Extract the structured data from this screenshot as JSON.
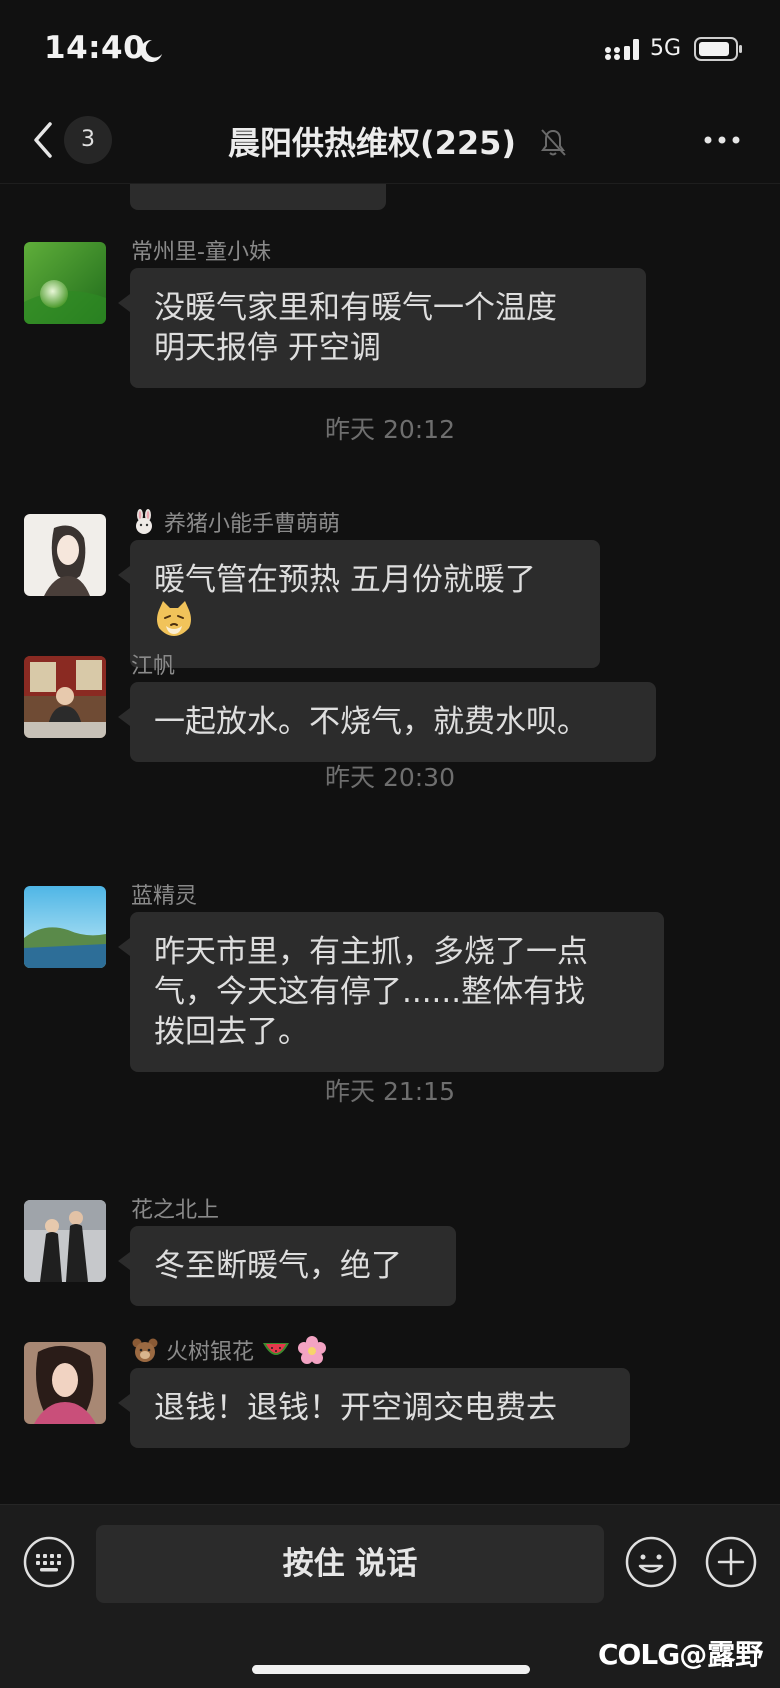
{
  "status_bar": {
    "time": "14:40",
    "network": "5G",
    "icons": [
      "moon-icon",
      "signal-icon",
      "battery-icon"
    ]
  },
  "header": {
    "unread_count": "3",
    "title": "晨阳供热维权(225)",
    "icons": [
      "back-icon",
      "mute-icon",
      "more-icon"
    ]
  },
  "messages": [
    {
      "sender": "常州里-童小妹",
      "text_lines": [
        "没暖气家里和有暖气一个温度",
        "明天报停 开空调"
      ]
    },
    {
      "timestamp": "昨天 20:12"
    },
    {
      "sender": "养猪小能手曹萌萌",
      "sender_prefix_icon": "rabbit-icon",
      "text": "暖气管在预热 五月份就暖了",
      "trailing_icon": "cat-emoji-icon"
    },
    {
      "sender": "江帆",
      "text": "一起放水。不烧气，就费水呗。"
    },
    {
      "timestamp": "昨天 20:30"
    },
    {
      "sender": "蓝精灵",
      "text_lines": [
        "昨天市里，有主抓，多烧了一点",
        "气，今天这有停了......整体有找",
        "拨回去了。"
      ]
    },
    {
      "timestamp": "昨天 21:15"
    },
    {
      "sender": "花之北上",
      "text": "冬至断暖气，绝了"
    },
    {
      "sender": "火树银花",
      "sender_prefix_icon": "bear-icon",
      "sender_suffix_icons": [
        "watermelon-icon",
        "flower-icon"
      ],
      "text": "退钱！退钱！开空调交电费去"
    }
  ],
  "input_bar": {
    "talk_label": "按住 说话",
    "icons": [
      "keyboard-icon",
      "emoji-icon",
      "plus-icon"
    ]
  },
  "watermark": {
    "brand": "COLG",
    "handle": "@露野"
  },
  "colors": {
    "background": "#111111",
    "bubble": "#2c2c2c",
    "text": "#dedede",
    "muted": "#6e6e6e"
  }
}
